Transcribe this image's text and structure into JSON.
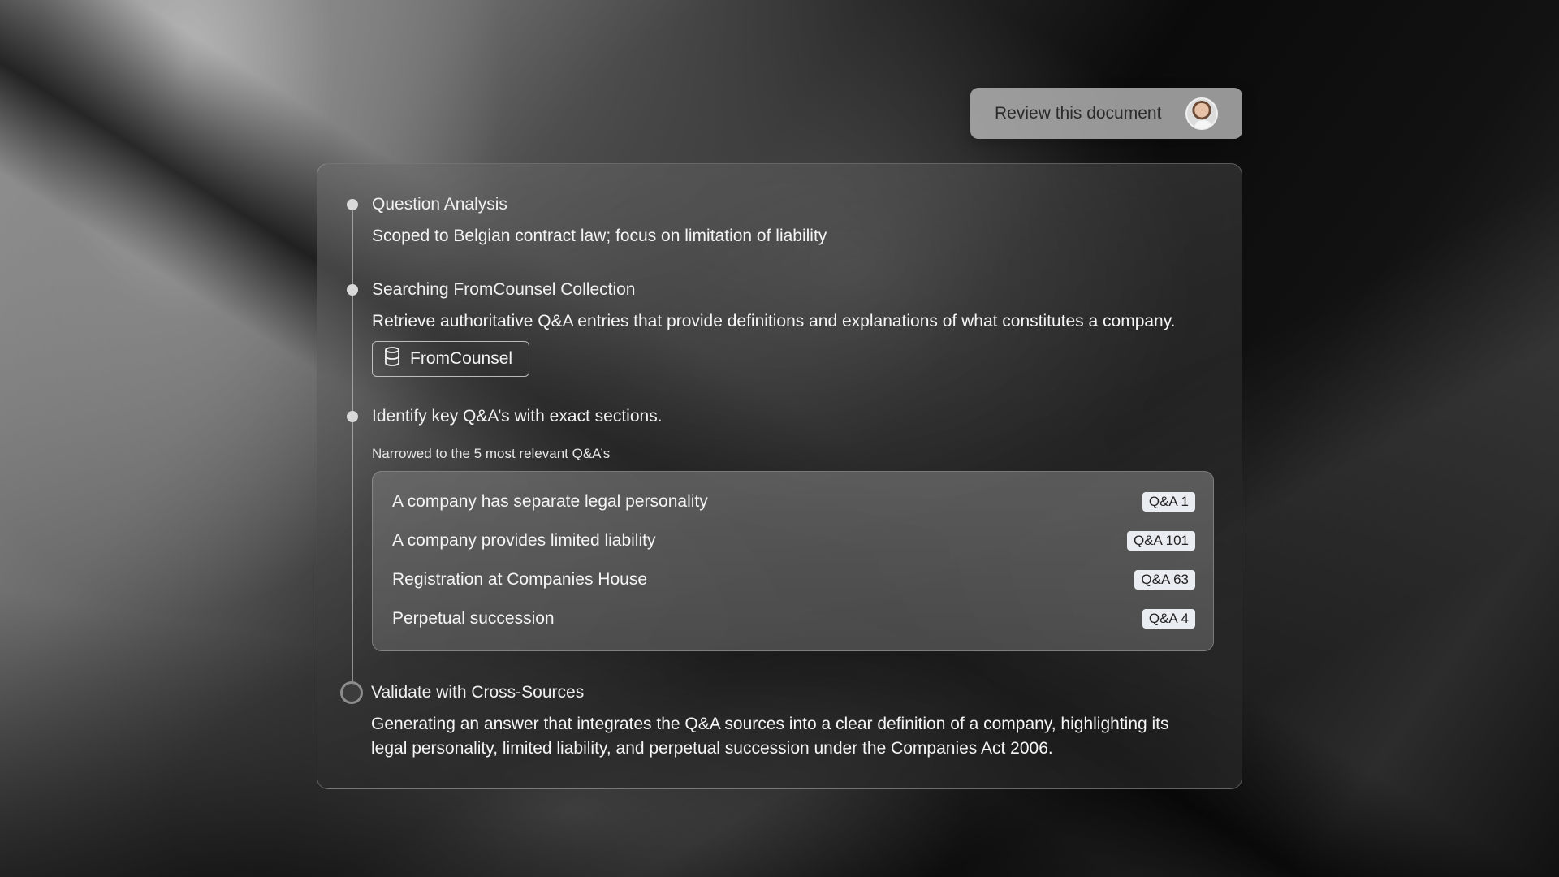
{
  "user_message": {
    "label": "Review this document",
    "avatar_icon": "user-avatar"
  },
  "steps": [
    {
      "title": "Question Analysis",
      "description": "Scoped to Belgian contract law; focus on limitation of liability"
    },
    {
      "title": "Searching FromCounsel Collection",
      "description": "Retrieve authoritative Q&A entries that provide definitions and explanations of what constitutes a company.",
      "source": {
        "icon": "database-icon",
        "label": "FromCounsel"
      }
    },
    {
      "title": "Identify key Q&A’s with exact sections.",
      "subtitle": "Narrowed to the 5 most relevant Q&A’s",
      "results": [
        {
          "text": "A company has separate legal personality",
          "tag": "Q&A 1"
        },
        {
          "text": "A company provides limited liability",
          "tag": "Q&A 101"
        },
        {
          "text": "Registration at Companies House",
          "tag": "Q&A 63"
        },
        {
          "text": "Perpetual succession",
          "tag": "Q&A 4"
        }
      ]
    },
    {
      "title": "Validate with Cross-Sources",
      "description_line1": "Generating an answer that integrates the Q&A sources into a clear definition of a company, highlighting its",
      "description_line2": "legal personality, limited liability, and perpetual succession under the Companies Act 2006."
    }
  ]
}
